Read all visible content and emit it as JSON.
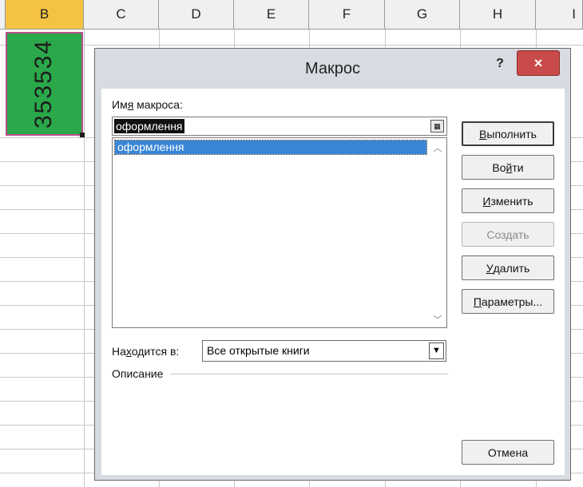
{
  "sheet": {
    "columns": [
      "B",
      "C",
      "D",
      "E",
      "F",
      "G",
      "H",
      "I"
    ],
    "selected_column": "B",
    "cell_b2_value": "353534",
    "colors": {
      "cell_fill": "#2aa84a",
      "selected_header": "#f5c342"
    }
  },
  "dialog": {
    "title": "Макрос",
    "help_label": "?",
    "close_label": "×",
    "name_label_pre": "Им",
    "name_label_u": "я",
    "name_label_post": " макроса:",
    "name_value": "оформлення",
    "macros": [
      "оформлення"
    ],
    "location_label_pre": "На",
    "location_label_u": "х",
    "location_label_post": "одится в:",
    "location_value": "Все открытые книги",
    "description_label": "Описание",
    "buttons": {
      "run_u": "В",
      "run_rest": "ыполнить",
      "step_pre": "Во",
      "step_u": "й",
      "step_post": "ти",
      "edit_u": "И",
      "edit_rest": "зменить",
      "create": "Создать",
      "delete_u": "У",
      "delete_rest": "далить",
      "options_u": "П",
      "options_rest": "араметры...",
      "cancel": "Отмена"
    },
    "colors": {
      "selection": "#3a86d6",
      "close_button": "#c94a4a"
    }
  }
}
